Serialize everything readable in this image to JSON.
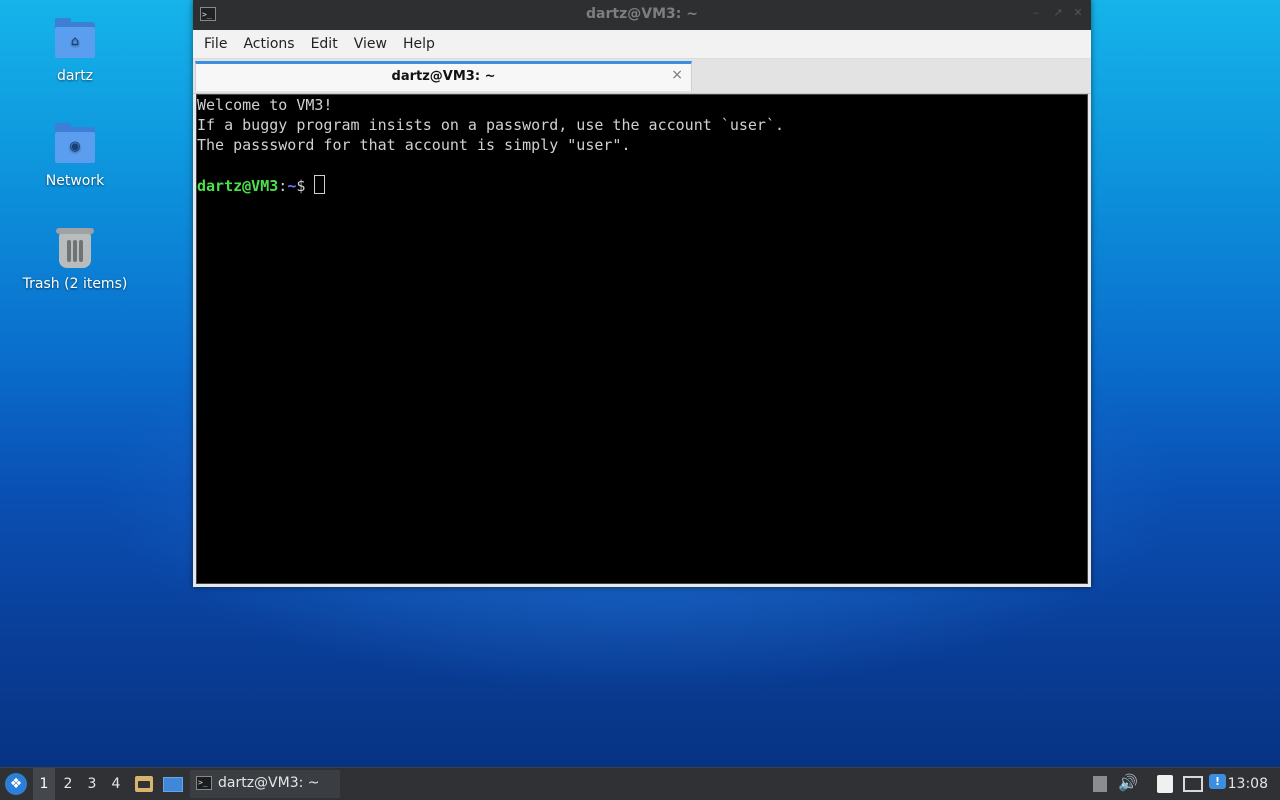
{
  "desktop": {
    "icons": [
      {
        "label": "dartz",
        "icon": "home-folder-icon"
      },
      {
        "label": "Network",
        "icon": "network-folder-icon"
      },
      {
        "label": "Trash (2 items)",
        "icon": "trash-icon"
      }
    ]
  },
  "window": {
    "title": "dartz@VM3: ~",
    "menu": [
      "File",
      "Actions",
      "Edit",
      "View",
      "Help"
    ],
    "tab": {
      "label": "dartz@VM3: ~",
      "close": "×"
    }
  },
  "terminal": {
    "lines": [
      "Welcome to VM3!",
      "If a buggy program insists on a password, use the account `user`.",
      "The passsword for that account is simply \"user\"."
    ],
    "prompt": {
      "user_host": "dartz@VM3",
      "colon": ":",
      "path": "~",
      "symbol": "$"
    }
  },
  "taskbar": {
    "workspaces": [
      "1",
      "2",
      "3",
      "4"
    ],
    "active_workspace": "1",
    "task_label": "dartz@VM3: ~",
    "clock": "13:08"
  },
  "colors": {
    "prompt_user": "#4ce14c",
    "prompt_path": "#6b7bff",
    "accent": "#3b8ee0"
  }
}
